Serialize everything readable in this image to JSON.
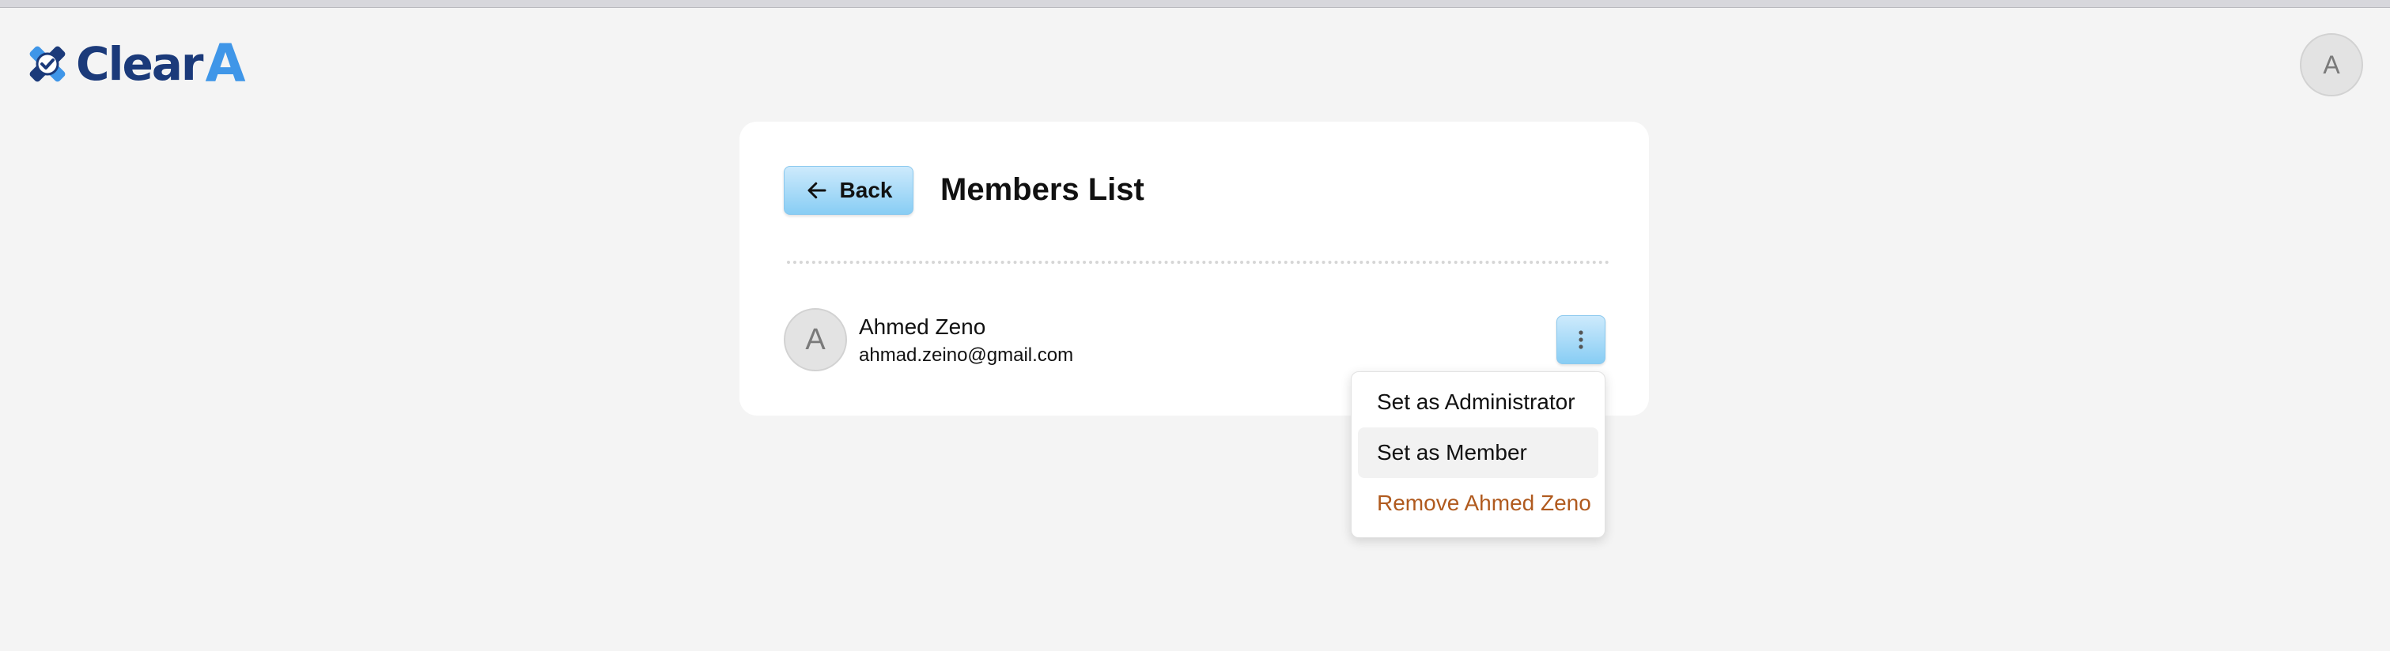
{
  "header": {
    "logo_text": "Clear",
    "logo_accent": "A",
    "user_avatar_initial": "A"
  },
  "page": {
    "title": "Members List",
    "back_label": "Back"
  },
  "members": [
    {
      "initial": "A",
      "name": "Ahmed Zeno",
      "email": "ahmad.zeino@gmail.com"
    }
  ],
  "member_menu": {
    "items": [
      {
        "label": "Set as Administrator"
      },
      {
        "label": "Set as Member"
      },
      {
        "label": "Remove Ahmed Zeno"
      }
    ]
  },
  "colors": {
    "button_gradient_top": "#cdeafc",
    "button_gradient_bottom": "#88cdf4",
    "logo_dark": "#1b3a7a",
    "logo_light": "#3f96e8",
    "danger_text": "#b05a1e"
  },
  "icons": [
    "logo-mark-icon",
    "arrow-left-icon",
    "kebab-menu-icon"
  ]
}
